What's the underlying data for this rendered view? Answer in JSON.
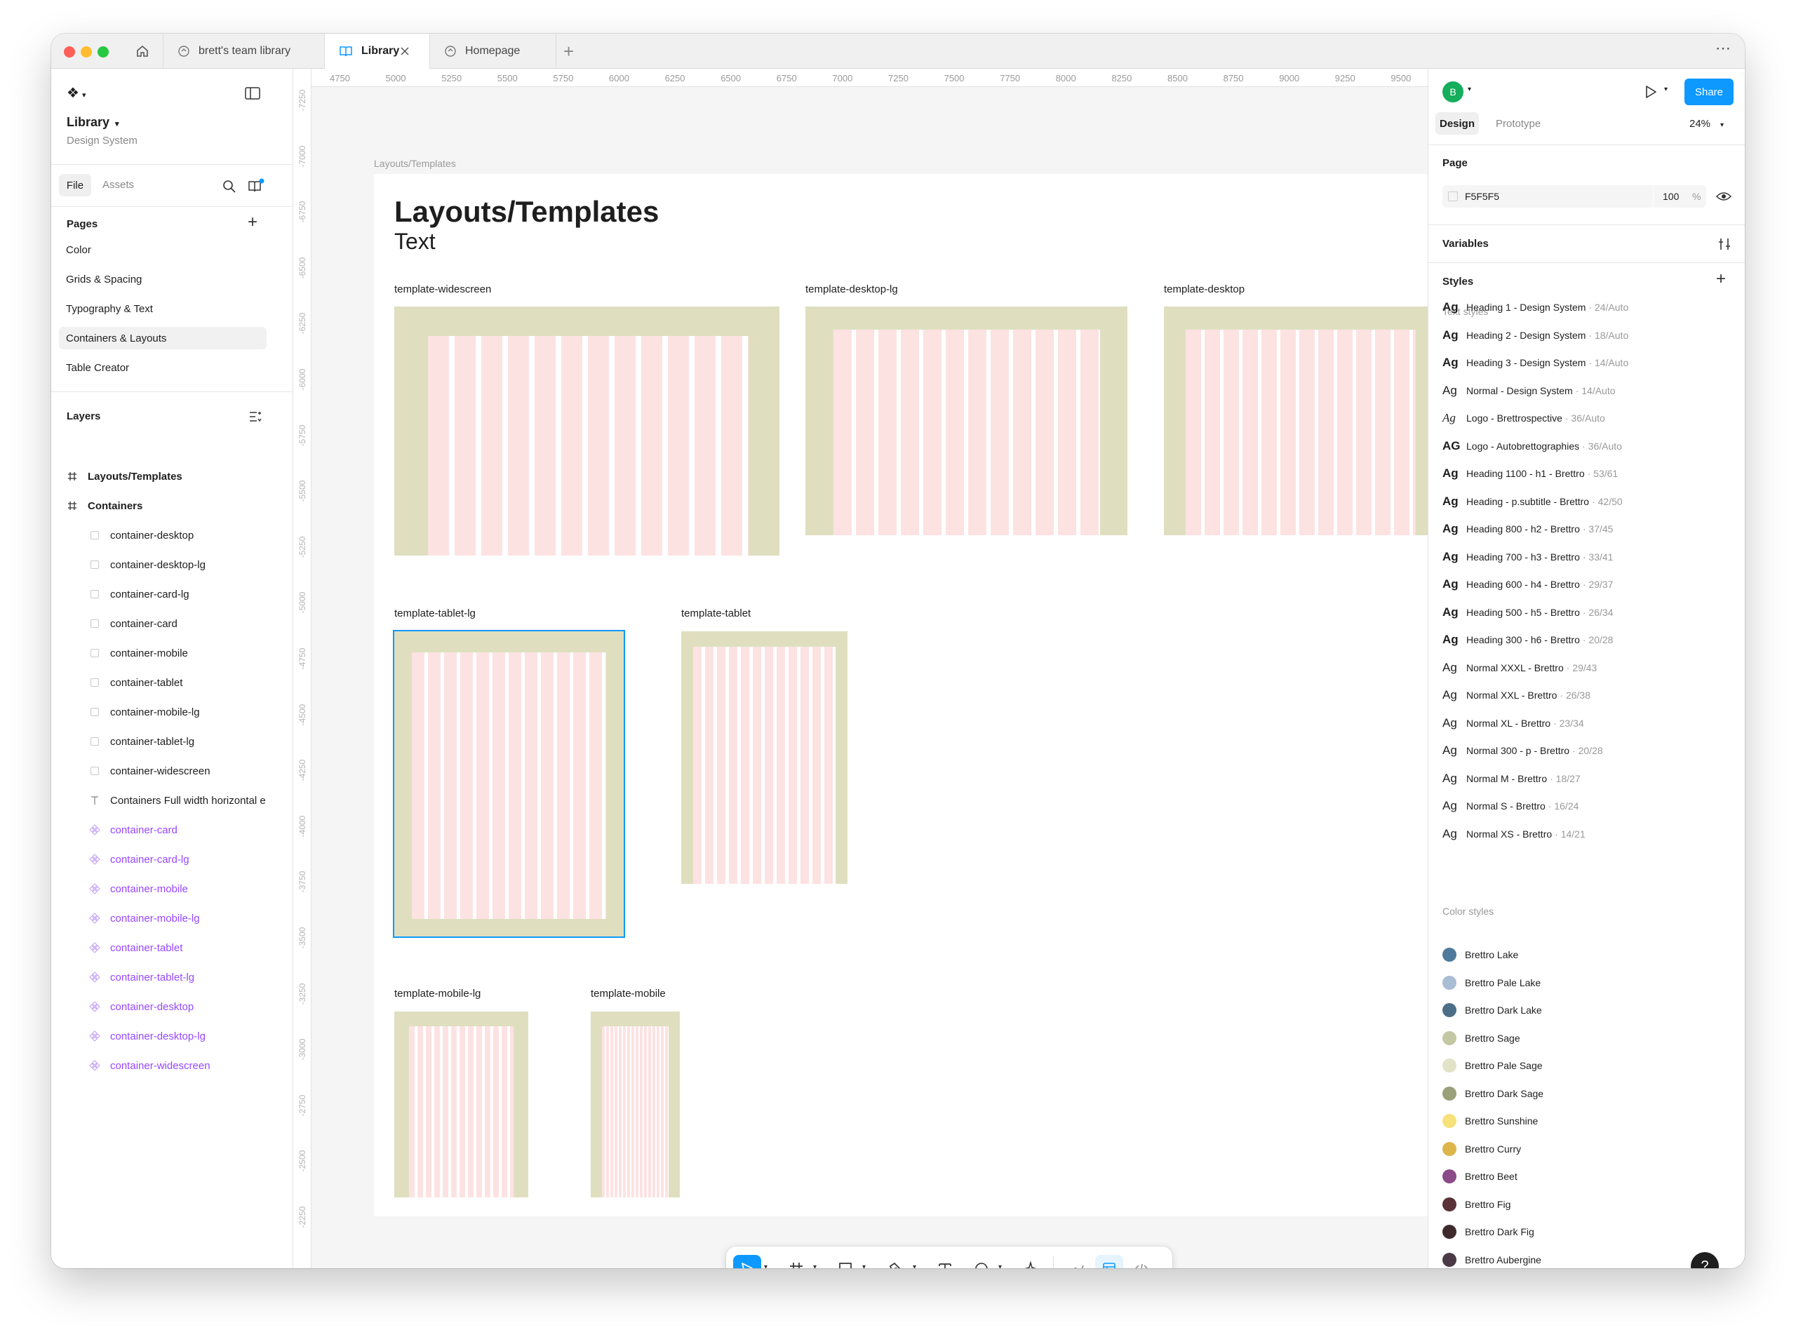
{
  "tabs": [
    {
      "label": "brett's team library"
    },
    {
      "label": "Library"
    },
    {
      "label": "Homepage"
    }
  ],
  "file": {
    "name": "Library",
    "subtitle": "Design System"
  },
  "left_tabs": {
    "file": "File",
    "assets": "Assets"
  },
  "pages": {
    "header": "Pages",
    "items": [
      "Color",
      "Grids & Spacing",
      "Typography & Text",
      "Containers & Layouts",
      "Table Creator"
    ]
  },
  "layers": {
    "header": "Layers",
    "items": [
      {
        "label": "Layouts/Templates",
        "kind": "frame"
      },
      {
        "label": "Containers",
        "kind": "frame"
      },
      {
        "label": "container-desktop",
        "kind": "rect"
      },
      {
        "label": "container-desktop-lg",
        "kind": "rect"
      },
      {
        "label": "container-card-lg",
        "kind": "rect"
      },
      {
        "label": "container-card",
        "kind": "rect"
      },
      {
        "label": "container-mobile",
        "kind": "rect"
      },
      {
        "label": "container-tablet",
        "kind": "rect"
      },
      {
        "label": "container-mobile-lg",
        "kind": "rect"
      },
      {
        "label": "container-tablet-lg",
        "kind": "rect"
      },
      {
        "label": "container-widescreen",
        "kind": "rect"
      },
      {
        "label": "Containers Full width horizontal e",
        "kind": "text"
      },
      {
        "label": "container-card",
        "kind": "component"
      },
      {
        "label": "container-card-lg",
        "kind": "component"
      },
      {
        "label": "container-mobile",
        "kind": "component"
      },
      {
        "label": "container-mobile-lg",
        "kind": "component"
      },
      {
        "label": "container-tablet",
        "kind": "component"
      },
      {
        "label": "container-tablet-lg",
        "kind": "component"
      },
      {
        "label": "container-desktop",
        "kind": "component"
      },
      {
        "label": "container-desktop-lg",
        "kind": "component"
      },
      {
        "label": "container-widescreen",
        "kind": "component"
      }
    ]
  },
  "ruler": {
    "h": [
      "4750",
      "5000",
      "5250",
      "5500",
      "5750",
      "6000",
      "6250",
      "6500",
      "6750",
      "7000",
      "7250",
      "7500",
      "7750",
      "8000",
      "8250",
      "8500",
      "8750",
      "9000",
      "9250",
      "9500"
    ],
    "v": [
      "-7250",
      "-7000",
      "-6750",
      "-6500",
      "-6250",
      "-6000",
      "-5750",
      "-5500",
      "-5250",
      "-5000",
      "-4750",
      "-4500",
      "-4250",
      "-4000",
      "-3750",
      "-3500",
      "-3250",
      "-3000",
      "-2750",
      "-2500",
      "-2250"
    ]
  },
  "canvas": {
    "breadcrumb": "Layouts/Templates",
    "title": "Layouts/Templates",
    "subtitle": "Text",
    "templates": [
      "template-widescreen",
      "template-desktop-lg",
      "template-desktop",
      "template-tablet-lg",
      "template-tablet",
      "template-mobile-lg",
      "template-mobile"
    ]
  },
  "right": {
    "avatar": "B",
    "share": "Share",
    "tab_design": "Design",
    "tab_prototype": "Prototype",
    "zoom": "24%",
    "page_label": "Page",
    "page_color": "F5F5F5",
    "page_opacity": "100",
    "percent": "%",
    "variables": "Variables",
    "styles": "Styles",
    "text_styles_header": "Text styles",
    "color_styles_header": "Color styles",
    "text_styles": [
      {
        "name": "Heading 1 - Design System",
        "meta": "· 24/Auto",
        "glyph": "Ag",
        "bold": true
      },
      {
        "name": "Heading 2 - Design System",
        "meta": "· 18/Auto",
        "glyph": "Ag",
        "bold": true
      },
      {
        "name": "Heading 3 - Design System",
        "meta": "· 14/Auto",
        "glyph": "Ag",
        "bold": true
      },
      {
        "name": "Normal - Design System",
        "meta": "· 14/Auto",
        "glyph": "Ag",
        "bold": false
      },
      {
        "name": "Logo - Brettrospective",
        "meta": "· 36/Auto",
        "glyph": "Ag",
        "bold": false
      },
      {
        "name": "Logo - Autobrettographies",
        "meta": "· 36/Auto",
        "glyph": "AG",
        "bold": true
      },
      {
        "name": "Heading 1100 - h1 - Brettro",
        "meta": "· 53/61",
        "glyph": "Ag",
        "bold": true
      },
      {
        "name": "Heading - p.subtitle - Brettro",
        "meta": "· 42/50",
        "glyph": "Ag",
        "bold": true
      },
      {
        "name": "Heading 800 - h2 - Brettro",
        "meta": "· 37/45",
        "glyph": "Ag",
        "bold": true
      },
      {
        "name": "Heading 700 - h3 - Brettro",
        "meta": "· 33/41",
        "glyph": "Ag",
        "bold": true
      },
      {
        "name": "Heading 600 - h4 - Brettro",
        "meta": "· 29/37",
        "glyph": "Ag",
        "bold": true
      },
      {
        "name": "Heading 500 - h5 - Brettro",
        "meta": "· 26/34",
        "glyph": "Ag",
        "bold": true
      },
      {
        "name": "Heading 300 - h6 - Brettro",
        "meta": "· 20/28",
        "glyph": "Ag",
        "bold": true
      },
      {
        "name": "Normal XXXL - Brettro",
        "meta": "· 29/43",
        "glyph": "Ag",
        "bold": false
      },
      {
        "name": "Normal XXL - Brettro",
        "meta": "· 26/38",
        "glyph": "Ag",
        "bold": false
      },
      {
        "name": "Normal XL - Brettro",
        "meta": "· 23/34",
        "glyph": "Ag",
        "bold": false
      },
      {
        "name": "Normal 300 - p - Brettro",
        "meta": "· 20/28",
        "glyph": "Ag",
        "bold": false
      },
      {
        "name": "Normal M - Brettro",
        "meta": "· 18/27",
        "glyph": "Ag",
        "bold": false
      },
      {
        "name": "Normal S - Brettro",
        "meta": "· 16/24",
        "glyph": "Ag",
        "bold": false
      },
      {
        "name": "Normal XS - Brettro",
        "meta": "· 14/21",
        "glyph": "Ag",
        "bold": false
      }
    ],
    "color_styles": [
      {
        "name": "Brettro Lake",
        "color": "#4f7a9c"
      },
      {
        "name": "Brettro Pale Lake",
        "color": "#a9bdd3"
      },
      {
        "name": "Brettro Dark Lake",
        "color": "#4d6e87"
      },
      {
        "name": "Brettro Sage",
        "color": "#c3c8a3"
      },
      {
        "name": "Brettro Pale Sage",
        "color": "#e2e3c6"
      },
      {
        "name": "Brettro Dark Sage",
        "color": "#99a07a"
      },
      {
        "name": "Brettro Sunshine",
        "color": "#f7e17a"
      },
      {
        "name": "Brettro Curry",
        "color": "#ddb54a"
      },
      {
        "name": "Brettro Beet",
        "color": "#8a4b86"
      },
      {
        "name": "Brettro Fig",
        "color": "#5a3238"
      },
      {
        "name": "Brettro Dark Fig",
        "color": "#3e2a2d"
      },
      {
        "name": "Brettro Aubergine",
        "color": "#4a3a45"
      }
    ]
  },
  "help": "?"
}
